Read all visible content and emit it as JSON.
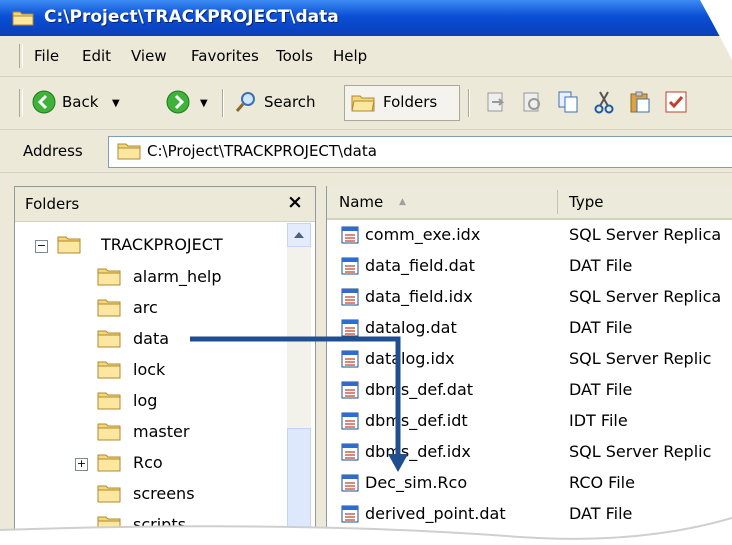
{
  "window": {
    "title": "C:\\Project\\TRACKPROJECT\\data"
  },
  "menu": [
    "File",
    "Edit",
    "View",
    "Favorites",
    "Tools",
    "Help"
  ],
  "toolbar": {
    "back_label": "Back",
    "search_label": "Search",
    "folders_label": "Folders",
    "icons": [
      "back-icon",
      "forward-icon",
      "search-icon",
      "folders-icon",
      "move-to-icon",
      "copy-to-icon",
      "copy-icon",
      "cut-icon",
      "paste-icon",
      "undo-icon"
    ]
  },
  "address": {
    "label": "Address",
    "path": "C:\\Project\\TRACKPROJECT\\data"
  },
  "folders_pane": {
    "title": "Folders",
    "close": "×",
    "tree": [
      {
        "label": "TRACKPROJECT",
        "expander": "−"
      },
      {
        "label": "alarm_help"
      },
      {
        "label": "arc"
      },
      {
        "label": "data"
      },
      {
        "label": "lock"
      },
      {
        "label": "log"
      },
      {
        "label": "master"
      },
      {
        "label": "Rco",
        "expander": "+"
      },
      {
        "label": "screens"
      },
      {
        "label": "scripts"
      }
    ]
  },
  "file_list": {
    "columns": {
      "name": "Name",
      "sort_arrow": "▲",
      "type": "Type"
    },
    "rows": [
      {
        "name": "comm_exe.idx",
        "type": "SQL Server Replica"
      },
      {
        "name": "data_field.dat",
        "type": "DAT File"
      },
      {
        "name": "data_field.idx",
        "type": "SQL Server Replica"
      },
      {
        "name": "datalog.dat",
        "type": "DAT File"
      },
      {
        "name": "datalog.idx",
        "type": "SQL Server Replic"
      },
      {
        "name": "dbms_def.dat",
        "type": "DAT File"
      },
      {
        "name": "dbms_def.idt",
        "type": "IDT File"
      },
      {
        "name": "dbms_def.idx",
        "type": "SQL Server Replic"
      },
      {
        "name": "Dec_sim.Rco",
        "type": "RCO File"
      },
      {
        "name": "derived_point.dat",
        "type": "DAT File"
      }
    ]
  },
  "colors": {
    "titlebar": "#0a4fd6",
    "arrow": "#1f4f8f",
    "folder": "#f5d77a"
  }
}
